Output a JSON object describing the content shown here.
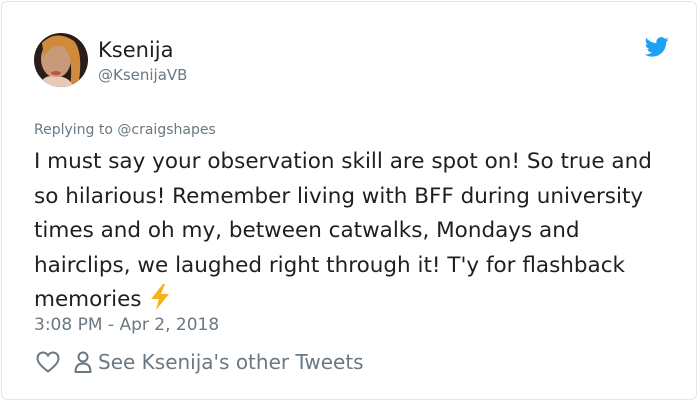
{
  "tweet": {
    "author_name": "Ksenija",
    "author_handle": "@KsenijaVB",
    "replying_to_prefix": "Replying to",
    "replying_to_handle": "@craigshapes",
    "text": "I must say your observation skill are spot on! So true and so hilarious! Remember living with BFF during university times and oh my, between catwalks, Mondays and hairclips, we laughed right through it! T'y for flashback memories",
    "emoji_icon": "lightning-bolt-icon",
    "timestamp": "3:08 PM - Apr 2, 2018",
    "other_tweets_label": "See Ksenija's other Tweets"
  },
  "icons": {
    "brand": "twitter-bird-icon",
    "like": "heart-icon",
    "profile": "person-icon"
  },
  "colors": {
    "twitter_blue": "#1da1f2",
    "text_primary": "#1c2022",
    "text_secondary": "#697882",
    "border": "#e1e8ed",
    "bolt": "#f7b21a"
  }
}
